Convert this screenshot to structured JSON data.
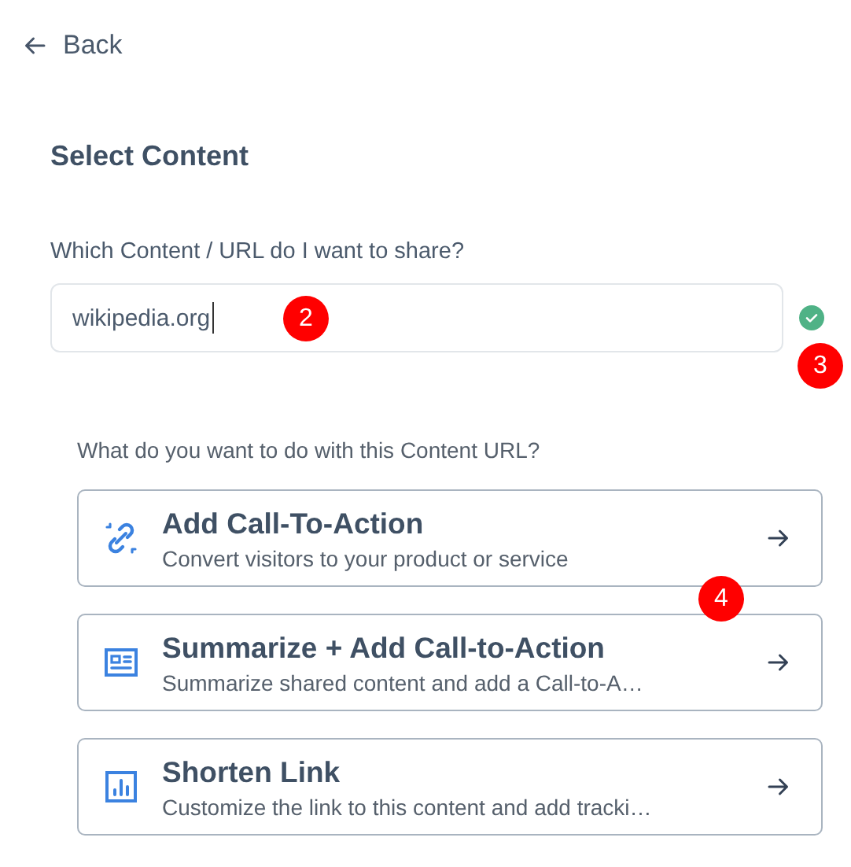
{
  "back": {
    "label": "Back"
  },
  "heading": "Select Content",
  "url_field": {
    "label": "Which Content / URL do I want to share?",
    "value": "wikipedia.org",
    "valid": true,
    "marker": "2",
    "valid_marker": "3"
  },
  "question": "What do you want to do with this Content URL?",
  "options": [
    {
      "kind": "link",
      "title": "Add Call-To-Action",
      "subtitle": "Convert visitors to your product or service",
      "marker": "4"
    },
    {
      "kind": "article",
      "title": "Summarize + Add Call-to-Action",
      "subtitle": "Summarize shared content and add a Call-to-A…"
    },
    {
      "kind": "chart",
      "title": "Shorten Link",
      "subtitle": "Customize the link to this content and add tracki…"
    }
  ]
}
